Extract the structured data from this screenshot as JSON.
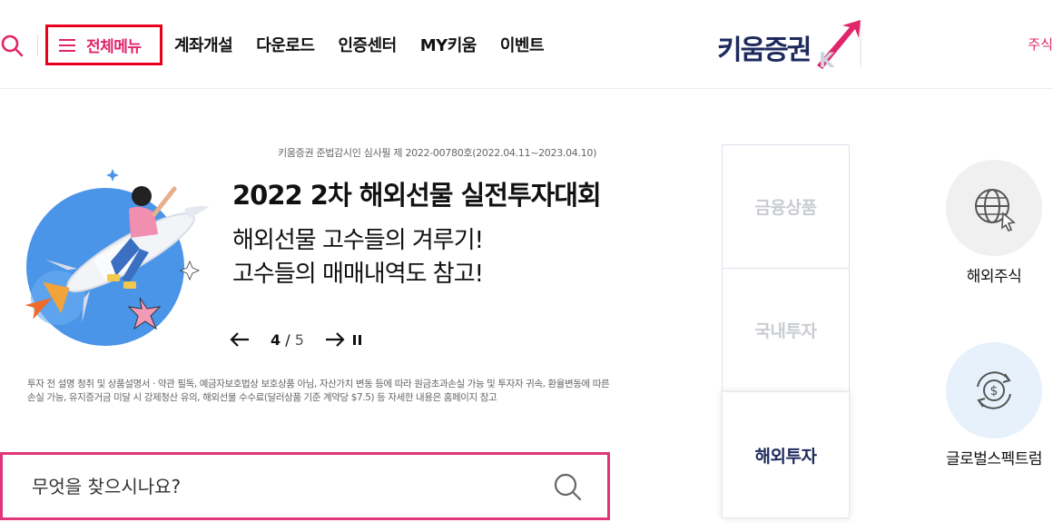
{
  "header": {
    "menu_label": "전체메뉴",
    "nav": [
      "계좌개설",
      "다운로드",
      "인증센터",
      "MY키움",
      "이벤트"
    ],
    "logo_text": "키움증권",
    "right_link": "주식"
  },
  "banner": {
    "notice": "키움증권 준법감시인 심사필 제 2022-00780호(2022.04.11~2023.04.10)",
    "title": "2022 2차 해외선물 실전투자대회",
    "subtitle_line1": "해외선물 고수들의 겨루기!",
    "subtitle_line2": "고수들의 매매내역도 참고!",
    "current_page": "4",
    "page_separator": "/",
    "total_pages": "5",
    "disclaimer": "투자 전 설명 청취 및 상품설명서 · 약관 필독, 예금자보호법상 보호상품 아님, 자산가치 변동 등에 따라 원금초과손실 가능 및 투자자 귀속, 환율변동에 따른 손실 가능, 유지증거금 미달 시 강제청산 유의, 해외선물 수수료(달러상품 기준 계약당 $7.5) 등 자세한 내용은 홈페이지 참고"
  },
  "search": {
    "placeholder": "무엇을 찾으시나요?"
  },
  "tabs": [
    {
      "label": "금융상품",
      "active": false
    },
    {
      "label": "국내투자",
      "active": false
    },
    {
      "label": "해외투자",
      "active": true
    }
  ],
  "quick_links": [
    {
      "label": "해외주식",
      "icon": "globe-cursor-icon"
    },
    {
      "label": "글로벌스펙트럼",
      "icon": "dollar-exchange-icon"
    }
  ],
  "colors": {
    "accent": "#e0256a",
    "highlight_border": "#e8001c",
    "brand_navy": "#1e2a5e",
    "search_border": "#e0357a"
  }
}
